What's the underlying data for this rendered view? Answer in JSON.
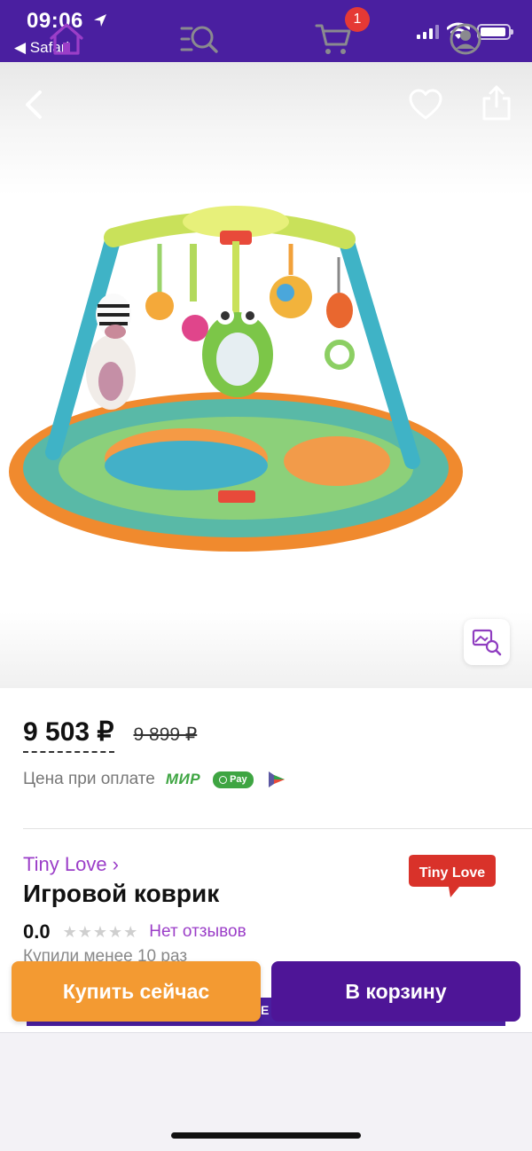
{
  "status_bar": {
    "time": "09:06",
    "back_app": "◀ Safari",
    "icons": [
      "location-arrow-icon",
      "signal-icon",
      "wifi-icon",
      "battery-icon"
    ]
  },
  "header": {
    "icons": [
      "back-arrow-icon",
      "heart-icon",
      "share-icon"
    ]
  },
  "product": {
    "image_alt": "Tiny Love play gym",
    "price": "9 503 ₽",
    "old_price": "9 899 ₽",
    "payment_note": "Цена при оплате",
    "mir_label": "МИР",
    "spay_label": "Pay",
    "brand_link": "Tiny Love ›",
    "brand_logo_text": "Tiny Love",
    "title": "Игровой коврик",
    "rating": "0.0",
    "stars": "★★★★★",
    "reviews": "Нет отзывов",
    "bought": "Купили менее 10 раз"
  },
  "actions": {
    "buy_now": "Купить сейчас",
    "add_to_cart": "В корзину",
    "hidden_strip_letter": "E"
  },
  "tabbar": {
    "items": [
      "home-icon",
      "catalog-search-icon",
      "cart-icon",
      "profile-icon"
    ],
    "cart_badge": "1"
  },
  "colors": {
    "brand_purple": "#4a1fa0",
    "cart_button": "#4e1597",
    "buy_button": "#f39a32",
    "link_purple": "#9b3ec8",
    "badge_red": "#e53935",
    "mir_green": "#3ea542"
  }
}
